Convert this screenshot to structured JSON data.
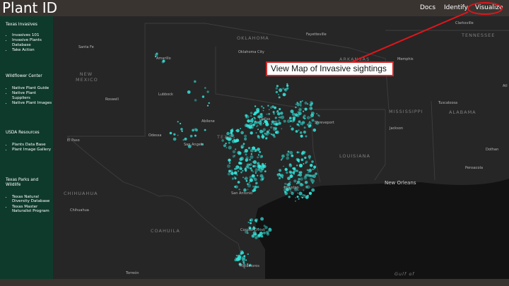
{
  "header": {
    "title": "Plant ID",
    "nav": {
      "docs": "Docs",
      "identify": "Identify",
      "visualize": "Visualize"
    }
  },
  "sidebar": {
    "sections": [
      {
        "title": "Texas Invasives",
        "items": [
          "Invasives 101",
          "Invasive Plants Database",
          "Take Action"
        ]
      },
      {
        "title": "Wildflower Center",
        "items": [
          "Native Plant Guide",
          "Native Plant Suppliers",
          "Native Plant Images"
        ]
      },
      {
        "title": "USDA Resources",
        "items": [
          "Plants Data Base",
          "Plant Image Gallery"
        ]
      },
      {
        "title": "Texas Parks and Wildlife",
        "items": [
          "Texas Natural Diversity Database",
          "Texas Master Naturalist Program"
        ]
      }
    ]
  },
  "annotation": {
    "callout": "View Map of Invasive sightings"
  },
  "map": {
    "states": {
      "oklahoma": "OKLAHOMA",
      "arkansas": "ARKANSAS",
      "tennessee": "TENNESSEE",
      "new_mexico": "NEW MEXICO",
      "texas": "TEXAS",
      "louisiana": "LOUISIANA",
      "mississippi": "MISSISSIPPI",
      "alabama": "ALABAMA",
      "chihuahua": "CHIHUAHUA",
      "coahuila": "COAHUILA"
    },
    "cities": {
      "santa_fe": "Santa Fe",
      "amarillo": "Amarillo",
      "oklahoma_city": "Oklahoma City",
      "fayetteville": "Fayetteville",
      "memphis": "Memphis",
      "clarksville": "Clarksville",
      "lubbock": "Lubbock",
      "roswell": "Roswell",
      "abilene": "Abilene",
      "dallas": "Dallas",
      "shreveport": "Shreveport",
      "tuscaloosa": "Tuscaloosa",
      "jackson": "Jackson",
      "odessa": "Odessa",
      "el_paso": "El Paso",
      "san_angelo": "San Angelo",
      "new_orleans": "New Orleans",
      "san_antonio": "San Antonio",
      "houston": "Houston",
      "dothan": "Dothan",
      "pensacola": "Pensacola",
      "chihuahua": "Chihuahua",
      "corpus_christi": "Corpus Christi",
      "matamoros": "Matamoros",
      "torreon": "Torreón",
      "gulf": "Gulf of",
      "atl": "Atl"
    },
    "colors": {
      "sightings": "#33e8de",
      "land": "#262626",
      "water": "#121212",
      "accent": "#e1151b"
    }
  }
}
